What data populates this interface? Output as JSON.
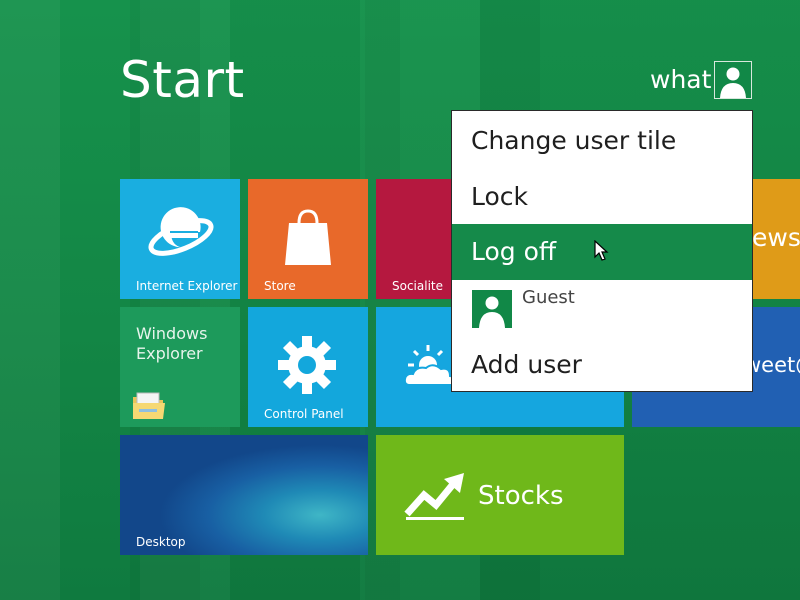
{
  "start": {
    "title": "Start"
  },
  "user": {
    "name": "what"
  },
  "tiles": {
    "internet_explorer": "Internet Explorer",
    "store": "Store",
    "socialite": "Socialite",
    "news": "ews",
    "windows_explorer": [
      "Windows",
      "Explorer"
    ],
    "control_panel": "Control Panel",
    "tweet": "weet@",
    "desktop": "Desktop",
    "stocks": "Stocks"
  },
  "user_menu": {
    "items": [
      "Change user tile",
      "Lock",
      "Log off",
      "Add user"
    ],
    "selected": "Log off",
    "guest_label": "Guest"
  },
  "colors": {
    "background": "#138645",
    "highlight": "#158a4a",
    "ie_tile": "#1aaee0",
    "store_tile": "#e8692a",
    "socialite_tile": "#b5183f",
    "news_tile": "#df9b18",
    "control_panel_tile": "#13a7dc",
    "stocks_tile": "#6fb81a"
  },
  "icons": {
    "user_avatar": "person-icon",
    "internet_explorer": "internet-explorer-icon",
    "store": "shopping-bag-icon",
    "control_panel": "gear-icon",
    "windows_explorer": "folder-icon",
    "weather": "sun-cloud-icon",
    "stocks": "chart-arrow-icon",
    "cursor": "mouse-pointer-icon"
  }
}
